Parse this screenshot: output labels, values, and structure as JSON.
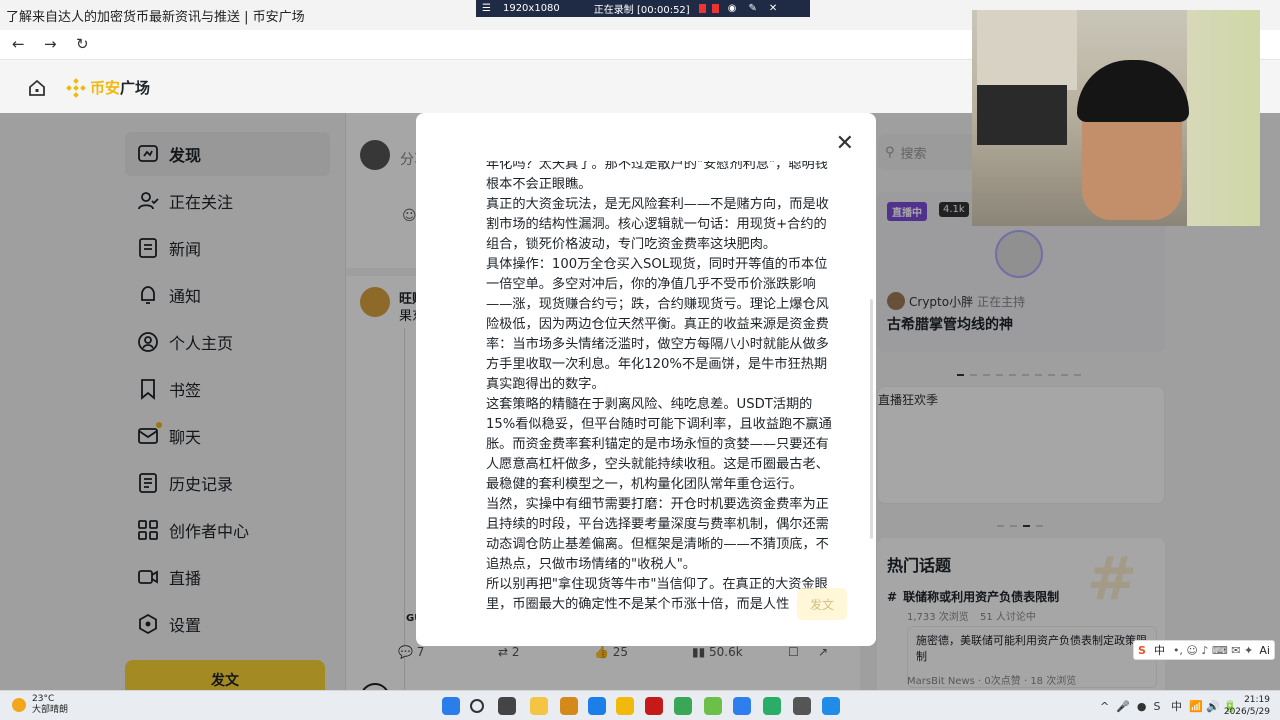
{
  "browser": {
    "tab_title": "了解来自达人的加密货币最新资讯与推送 | 币安广场",
    "back_icon": "←",
    "forward_icon": "→",
    "reload_icon": "↻"
  },
  "recorder": {
    "resolution": "1920x1080",
    "status": "正在录制 [00:00:52]"
  },
  "header": {
    "brand_part1": "币安",
    "brand_part2": "广场"
  },
  "sidebar": {
    "items": [
      {
        "label": "发现",
        "icon": "discover-icon",
        "active": true
      },
      {
        "label": "正在关注",
        "icon": "following-icon"
      },
      {
        "label": "新闻",
        "icon": "news-icon"
      },
      {
        "label": "通知",
        "icon": "bell-icon"
      },
      {
        "label": "个人主页",
        "icon": "profile-icon"
      },
      {
        "label": "书签",
        "icon": "bookmark-icon"
      },
      {
        "label": "聊天",
        "icon": "mail-icon"
      },
      {
        "label": "历史记录",
        "icon": "history-icon"
      },
      {
        "label": "创作者中心",
        "icon": "creator-icon"
      },
      {
        "label": "直播",
        "icon": "live-icon"
      },
      {
        "label": "设置",
        "icon": "settings-icon"
      }
    ],
    "post_button": "发文"
  },
  "feed": {
    "compose_placeholder": "分享",
    "post_name": "旺财",
    "post_sub": "果东",
    "quote_gu": "GU",
    "actions": {
      "comments": "7",
      "reposts": "2",
      "likes": "25",
      "views": "50.6k"
    }
  },
  "right": {
    "search_placeholder": "搜索",
    "live_badge": "直播中",
    "live_viewers": "4.1k",
    "host_name": "Crypto小胖",
    "host_status": "正在主持",
    "live_title": "古希腊掌管均线的神",
    "banner_alt": "直播狂欢季",
    "topics_heading": "热门话题",
    "topic_title": "联储称或利用资产负债表限制",
    "topic_meta_views": "1,733 次浏览",
    "topic_meta_discuss": "51 人讨论中",
    "news_text": "施密德，美联储可能利用资产负债表制定政策限制",
    "news_source": "MarsBit News",
    "news_likes": "0次点赞",
    "news_views": "18 次浏览"
  },
  "modal": {
    "paragraphs": [
      "年化吗？太天真了。那不过是散户的\"安慰剂利息\"，聪明钱根本不会正眼瞧。",
      "真正的大资金玩法，是无风险套利——不是赌方向，而是收割市场的结构性漏洞。核心逻辑就一句话：用现货+合约的组合，锁死价格波动，专门吃资金费率这块肥肉。",
      "具体操作：100万全仓买入SOL现货，同时开等值的币本位一倍空单。多空对冲后，你的净值几乎不受币价涨跌影响——涨，现货赚合约亏；跌，合约赚现货亏。理论上爆仓风险极低，因为两边仓位天然平衡。真正的收益来源是资金费率：当市场多头情绪泛滥时，做空方每隔八小时就能从做多方手里收取一次利息。年化120%不是画饼，是牛市狂热期真实跑得出的数字。",
      "这套策略的精髓在于剥离风险、纯吃息差。USDT活期的15%看似稳妥，但平台随时可能下调利率，且收益跑不赢通胀。而资金费率套利锚定的是市场永恒的贪婪——只要还有人愿意高杠杆做多，空头就能持续收租。这是币圈最古老、最稳健的套利模型之一，机构量化团队常年重仓运行。",
      "当然，实操中有细节需要打磨：开仓时机要选资金费率为正且持续的时段，平台选择要考量深度与费率机制，偶尔还需动态调仓防止基差偏离。但框架是清晰的——不猜顶底，不追热点，只做市场情绪的\"收税人\"。",
      "所以别再把\"拿住现货等牛市\"当信仰了。在真正的大资金眼里，币圈最大的确定性不是某个币涨十倍，而是人性"
    ],
    "fab_label": "发文"
  },
  "taskbar": {
    "temp": "23°C",
    "weather": "大部晴朗",
    "time": "21:19",
    "date": "2026/5/29"
  },
  "ime": {
    "lang": "中",
    "ai_label": "Ai"
  }
}
